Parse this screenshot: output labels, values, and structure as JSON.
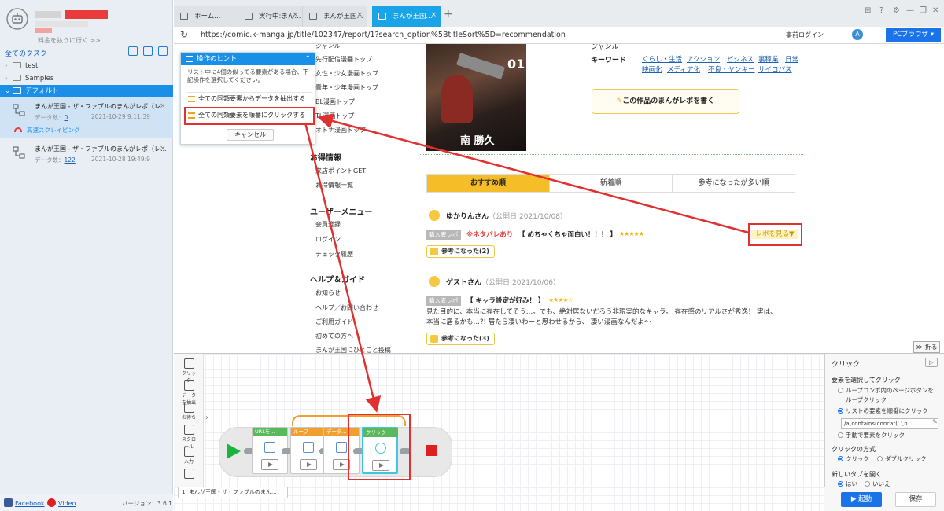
{
  "sidebar": {
    "pay_link": "料金を払うに行く >>",
    "all_tasks": "全てのタスク",
    "tree": [
      {
        "label": "test"
      },
      {
        "label": "Samples"
      },
      {
        "label": "デフォルト"
      }
    ],
    "tasks": [
      {
        "title": "まんが王国 - ザ・ファブルのまんがレポ（レ...",
        "meta_label": "データ数：",
        "count": "0",
        "date": "2021-10-29 9:11:39",
        "status": "高速スクレイピング"
      },
      {
        "title": "まんが王国 - ザ・ファブルのまんがレポ（レ...",
        "meta_label": "データ数：",
        "count": "122",
        "date": "2021-10-28 19:49:9"
      }
    ],
    "footer": {
      "facebook": "Facebook",
      "video": "Video",
      "version": "バージョン：3.6.1"
    }
  },
  "browser": {
    "tabs": [
      {
        "label": "ホーム..."
      },
      {
        "label": "実行中:まん..."
      },
      {
        "label": "まんが王国..."
      },
      {
        "label": "まんが王国..."
      }
    ],
    "url": "https://comic.k-manga.jp/title/102347/report/1?search_option%5BtitleSort%5D=recommendation",
    "pre_login": "事前ログイン",
    "avatar": "A",
    "ua_button": "PCブラウザ ▾"
  },
  "page": {
    "menu_top": [
      "ジャンル",
      "先行配信漫画トップ",
      "女性・少女漫画トップ",
      "青年・少年漫画トップ",
      "BL漫画トップ",
      "TL漫画トップ",
      "オトナ漫画トップ"
    ],
    "section_deals": "お得情報",
    "menu_deals": [
      "来店ポイントGET",
      "お得情報一覧"
    ],
    "section_user": "ユーザーメニュー",
    "menu_user": [
      "会員登録",
      "ログイン",
      "チェック履歴"
    ],
    "section_help": "ヘルプ＆ガイド",
    "menu_help": [
      "お知らせ",
      "ヘルプ／お問い合わせ",
      "ご利用ガイド",
      "初めての方へ",
      "まんが王国にひとこと投稿"
    ],
    "cover_title": "南 勝久",
    "cover_vol": "01",
    "genre_label": "ジャンル",
    "keyword_label": "キーワード",
    "keywords": [
      "くらし・生活",
      "アクション",
      "ビジネス",
      "裏稼業",
      "日常",
      "映画化",
      "メディア化",
      "不良・ヤンキー",
      "サイコパス"
    ],
    "write_button": "この作品のまんがレポを書く",
    "sort_tabs": [
      "おすすめ順",
      "新着順",
      "参考になったが多い順"
    ],
    "reviews": [
      {
        "name": "ゆかりんさん",
        "date": "（公開日:2021/10/08）",
        "badge": "購入者レポ",
        "spoiler": "※ネタバレあり",
        "title": "【 めちゃくちゃ面白い！！！ 】",
        "stars": "★★★★★",
        "helpful": "参考になった(2)",
        "more": "レポを見る▼"
      },
      {
        "name": "ゲストさん",
        "date": "（公開日:2021/10/06）",
        "badge": "購入者レポ",
        "title": "【 キャラ設定が好み！ 】",
        "stars": "★★★★☆",
        "body1": "見た目的に、本当に存在してそう…。でも、絶対居ないだろう非現実的なキャラ。 存在感のリアルさが秀逸！ 実は、",
        "body2": "本当に居るかも…?! 居たら凄いわーと思わせるから、 凄い漫画なんだよ～",
        "helpful": "参考になった(3)"
      }
    ]
  },
  "hint": {
    "title": "操作のヒント",
    "text": "リスト中に4個の似ってる要素がある場合、下記操作を選択してください。",
    "options": [
      "全ての同類要素からデータを抽出する",
      "全ての同類要素を順番にクリックする"
    ],
    "cancel": "キャンセル"
  },
  "workflow": {
    "fold": "≫ 折る",
    "tools": [
      "クリック",
      "データを抽出",
      "お待ち",
      "スクロール",
      "入力",
      ""
    ],
    "steps": [
      {
        "label": "URLを...",
        "color": "#5cb85c"
      },
      {
        "label": "ループ",
        "color": "#f0a030"
      },
      {
        "label": "データ...",
        "color": "#f0a030"
      },
      {
        "label": "クリック",
        "color": "#5cb85c"
      }
    ],
    "flow_tab": "1. まんが王国 - ザ・ファブルのまん..."
  },
  "settings": {
    "title": "クリック",
    "help": "▷",
    "section_select": "要素を選択してクリック",
    "opt_loop_page": "ループコンポ内のページボタンを",
    "opt_loop_page2": "ループクリック",
    "opt_list": "リストの要素を順番にクリック",
    "xpath": "/a[contains(concat(' ',n",
    "opt_manual": "手動で要素をクリック",
    "section_method": "クリックの方式",
    "method_click": "クリック",
    "method_double": "ダブルクリック",
    "section_newtab": "新しいタブを開く",
    "newtab_yes": "はい",
    "newtab_no": "いいえ",
    "start_button": "▶ 起動",
    "save_button": "保存"
  },
  "colors": {
    "accent": "#1a8fe8",
    "highlight": "#e03030",
    "brand_yellow": "#f5bd28"
  }
}
